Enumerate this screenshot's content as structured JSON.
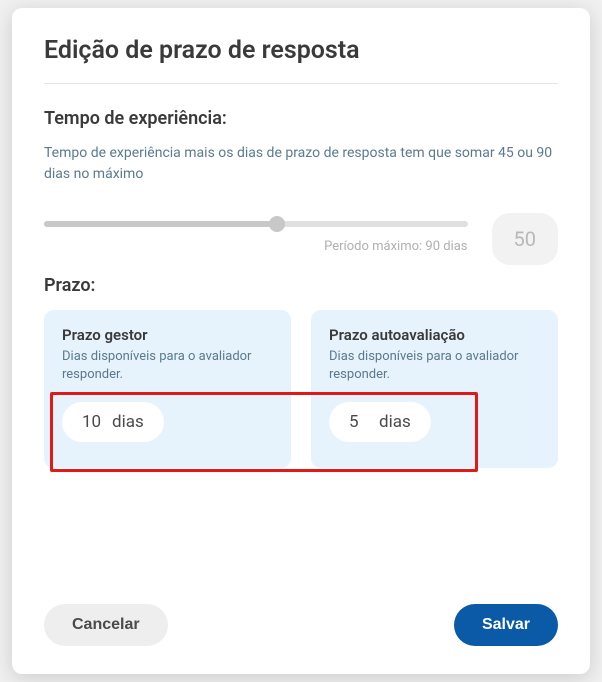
{
  "modal": {
    "title": "Edição de prazo de resposta"
  },
  "experience": {
    "label": "Tempo de experiência:",
    "help": "Tempo de experiência mais os dias de prazo de resposta tem que somar 45 ou 90 dias no máximo",
    "caption": "Período máximo: 90 dias",
    "value": "50"
  },
  "prazo": {
    "label": "Prazo:",
    "gestor": {
      "title": "Prazo gestor",
      "sub": "Dias disponíveis para o avaliador responder.",
      "value": "10",
      "unit": "dias"
    },
    "auto": {
      "title": "Prazo autoavaliação",
      "sub": "Dias disponíveis para o avaliador responder.",
      "value": "5",
      "unit": "dias"
    }
  },
  "footer": {
    "cancel": "Cancelar",
    "save": "Salvar"
  }
}
